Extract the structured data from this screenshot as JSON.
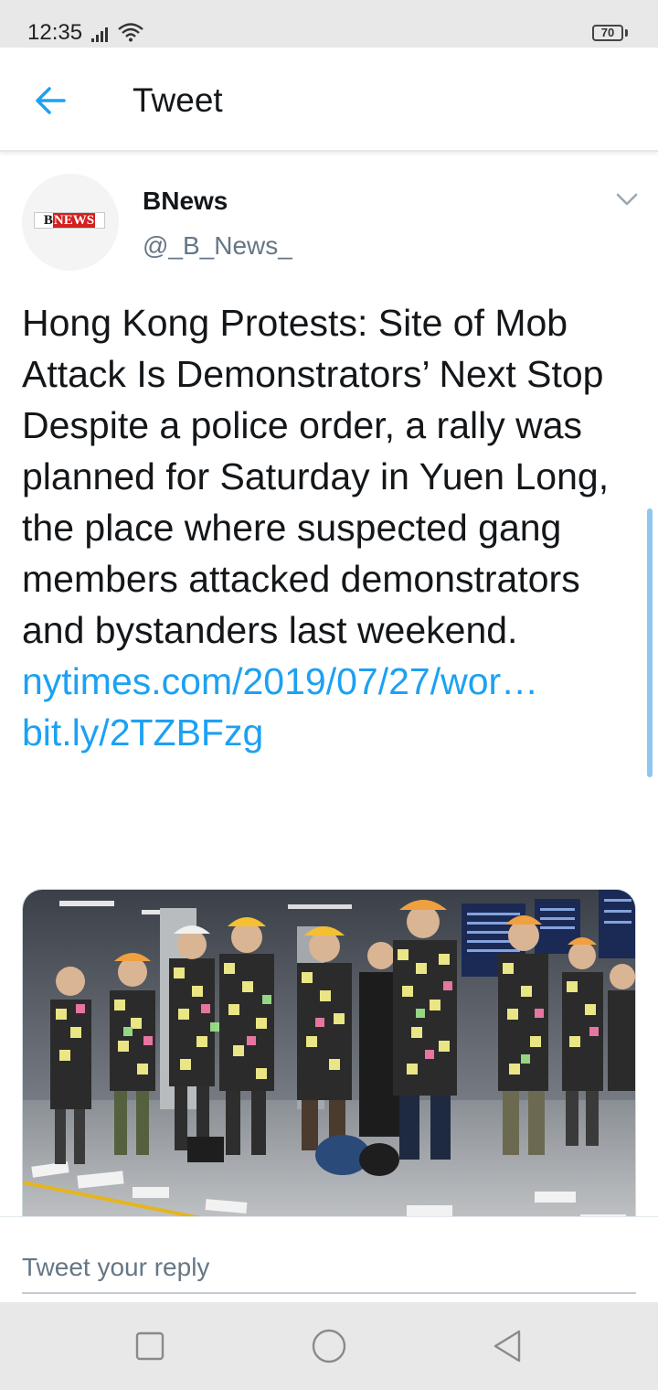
{
  "status_bar": {
    "time": "12:35",
    "battery": "70"
  },
  "header": {
    "title": "Tweet",
    "back_icon": "arrow-left-icon",
    "accent_color": "#1da1f2"
  },
  "tweet": {
    "author": {
      "name": "BNews",
      "handle": "@_B_News_",
      "logo_text_b": "B",
      "logo_text_rest": "NEWS"
    },
    "headline": "Hong Kong Protests: Site of Mob Attack Is Demonstrators’ Next Stop",
    "body": "Despite a police order, a rally was planned for Saturday in Yuen Long, the place where suspected gang members attacked demonstrators and bystanders last weekend.",
    "links": [
      "nytimes.com/2019/07/27/wor…",
      "bit.ly/2TZBFzg"
    ],
    "media": {
      "type": "photo",
      "icon": "photo-image"
    }
  },
  "reply": {
    "placeholder": "Tweet your reply"
  },
  "nav": {
    "icons": [
      "recent-apps-icon",
      "home-icon",
      "back-triangle-icon"
    ]
  }
}
